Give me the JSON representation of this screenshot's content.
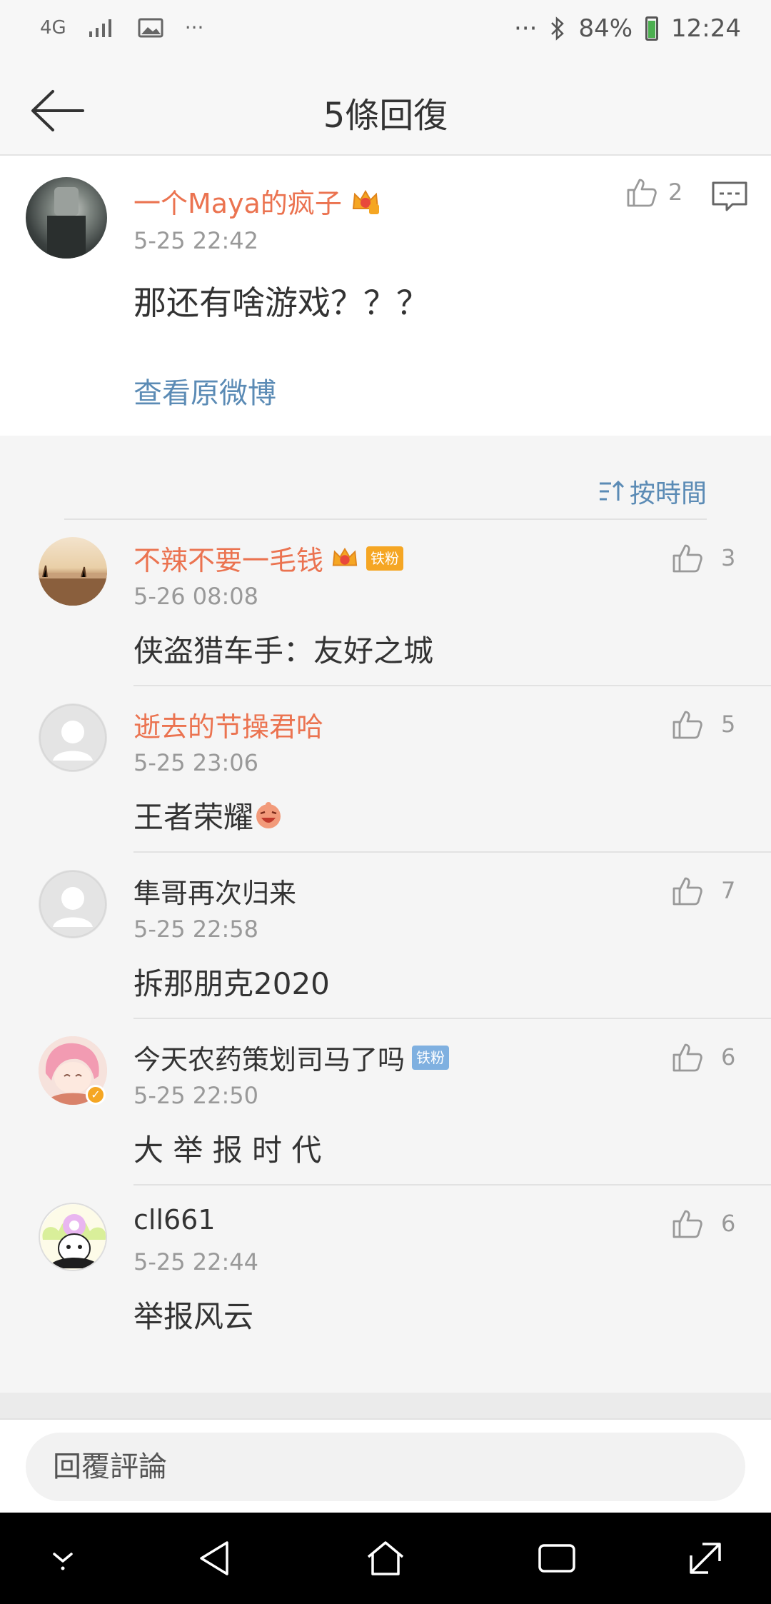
{
  "status_bar": {
    "network": "4G",
    "more": "···",
    "right_more": "···",
    "battery": "84%",
    "time": "12:24"
  },
  "nav": {
    "title": "5條回復"
  },
  "main_post": {
    "user": "一个Maya的疯子",
    "time": "5-25 22:42",
    "text": "那还有啥游戏？？？",
    "likes": "2",
    "view_original": "查看原微博"
  },
  "sort": {
    "label": "按時間"
  },
  "replies": [
    {
      "user": "不辣不要一毛钱",
      "fan_badge": "铁粉",
      "time": "5-26 08:08",
      "text": "侠盗猎车手：友好之城",
      "likes": "3"
    },
    {
      "user": "逝去的节操君哈",
      "time": "5-25 23:06",
      "text": "王者荣耀",
      "likes": "5"
    },
    {
      "user": "隼哥再次归来",
      "time": "5-25 22:58",
      "text": "拆那朋克2020",
      "likes": "7"
    },
    {
      "user": "今天农药策划司马了吗",
      "fan_badge": "铁粉",
      "time": "5-25 22:50",
      "text": "大 举 报 时 代",
      "likes": "6"
    },
    {
      "user": "cll661",
      "time": "5-25 22:44",
      "text": "举报风云",
      "likes": "6"
    }
  ],
  "footer": {
    "placeholder": "回覆評論"
  },
  "colors": {
    "name_orange": "#eb7350",
    "link_blue": "#5b8bb5",
    "meta_gray": "#999999"
  }
}
